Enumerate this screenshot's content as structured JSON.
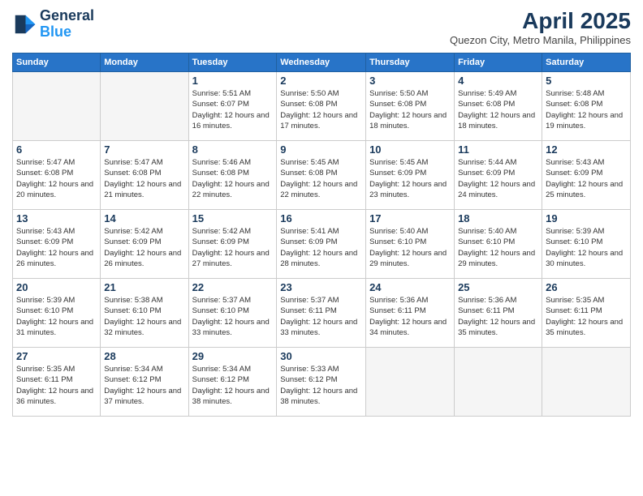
{
  "header": {
    "logo_line1": "General",
    "logo_line2": "Blue",
    "month_title": "April 2025",
    "location": "Quezon City, Metro Manila, Philippines"
  },
  "weekdays": [
    "Sunday",
    "Monday",
    "Tuesday",
    "Wednesday",
    "Thursday",
    "Friday",
    "Saturday"
  ],
  "weeks": [
    [
      {
        "day": "",
        "empty": true
      },
      {
        "day": "",
        "empty": true
      },
      {
        "day": "1",
        "sunrise": "Sunrise: 5:51 AM",
        "sunset": "Sunset: 6:07 PM",
        "daylight": "Daylight: 12 hours and 16 minutes."
      },
      {
        "day": "2",
        "sunrise": "Sunrise: 5:50 AM",
        "sunset": "Sunset: 6:08 PM",
        "daylight": "Daylight: 12 hours and 17 minutes."
      },
      {
        "day": "3",
        "sunrise": "Sunrise: 5:50 AM",
        "sunset": "Sunset: 6:08 PM",
        "daylight": "Daylight: 12 hours and 18 minutes."
      },
      {
        "day": "4",
        "sunrise": "Sunrise: 5:49 AM",
        "sunset": "Sunset: 6:08 PM",
        "daylight": "Daylight: 12 hours and 18 minutes."
      },
      {
        "day": "5",
        "sunrise": "Sunrise: 5:48 AM",
        "sunset": "Sunset: 6:08 PM",
        "daylight": "Daylight: 12 hours and 19 minutes."
      }
    ],
    [
      {
        "day": "6",
        "sunrise": "Sunrise: 5:47 AM",
        "sunset": "Sunset: 6:08 PM",
        "daylight": "Daylight: 12 hours and 20 minutes."
      },
      {
        "day": "7",
        "sunrise": "Sunrise: 5:47 AM",
        "sunset": "Sunset: 6:08 PM",
        "daylight": "Daylight: 12 hours and 21 minutes."
      },
      {
        "day": "8",
        "sunrise": "Sunrise: 5:46 AM",
        "sunset": "Sunset: 6:08 PM",
        "daylight": "Daylight: 12 hours and 22 minutes."
      },
      {
        "day": "9",
        "sunrise": "Sunrise: 5:45 AM",
        "sunset": "Sunset: 6:08 PM",
        "daylight": "Daylight: 12 hours and 22 minutes."
      },
      {
        "day": "10",
        "sunrise": "Sunrise: 5:45 AM",
        "sunset": "Sunset: 6:09 PM",
        "daylight": "Daylight: 12 hours and 23 minutes."
      },
      {
        "day": "11",
        "sunrise": "Sunrise: 5:44 AM",
        "sunset": "Sunset: 6:09 PM",
        "daylight": "Daylight: 12 hours and 24 minutes."
      },
      {
        "day": "12",
        "sunrise": "Sunrise: 5:43 AM",
        "sunset": "Sunset: 6:09 PM",
        "daylight": "Daylight: 12 hours and 25 minutes."
      }
    ],
    [
      {
        "day": "13",
        "sunrise": "Sunrise: 5:43 AM",
        "sunset": "Sunset: 6:09 PM",
        "daylight": "Daylight: 12 hours and 26 minutes."
      },
      {
        "day": "14",
        "sunrise": "Sunrise: 5:42 AM",
        "sunset": "Sunset: 6:09 PM",
        "daylight": "Daylight: 12 hours and 26 minutes."
      },
      {
        "day": "15",
        "sunrise": "Sunrise: 5:42 AM",
        "sunset": "Sunset: 6:09 PM",
        "daylight": "Daylight: 12 hours and 27 minutes."
      },
      {
        "day": "16",
        "sunrise": "Sunrise: 5:41 AM",
        "sunset": "Sunset: 6:09 PM",
        "daylight": "Daylight: 12 hours and 28 minutes."
      },
      {
        "day": "17",
        "sunrise": "Sunrise: 5:40 AM",
        "sunset": "Sunset: 6:10 PM",
        "daylight": "Daylight: 12 hours and 29 minutes."
      },
      {
        "day": "18",
        "sunrise": "Sunrise: 5:40 AM",
        "sunset": "Sunset: 6:10 PM",
        "daylight": "Daylight: 12 hours and 29 minutes."
      },
      {
        "day": "19",
        "sunrise": "Sunrise: 5:39 AM",
        "sunset": "Sunset: 6:10 PM",
        "daylight": "Daylight: 12 hours and 30 minutes."
      }
    ],
    [
      {
        "day": "20",
        "sunrise": "Sunrise: 5:39 AM",
        "sunset": "Sunset: 6:10 PM",
        "daylight": "Daylight: 12 hours and 31 minutes."
      },
      {
        "day": "21",
        "sunrise": "Sunrise: 5:38 AM",
        "sunset": "Sunset: 6:10 PM",
        "daylight": "Daylight: 12 hours and 32 minutes."
      },
      {
        "day": "22",
        "sunrise": "Sunrise: 5:37 AM",
        "sunset": "Sunset: 6:10 PM",
        "daylight": "Daylight: 12 hours and 33 minutes."
      },
      {
        "day": "23",
        "sunrise": "Sunrise: 5:37 AM",
        "sunset": "Sunset: 6:11 PM",
        "daylight": "Daylight: 12 hours and 33 minutes."
      },
      {
        "day": "24",
        "sunrise": "Sunrise: 5:36 AM",
        "sunset": "Sunset: 6:11 PM",
        "daylight": "Daylight: 12 hours and 34 minutes."
      },
      {
        "day": "25",
        "sunrise": "Sunrise: 5:36 AM",
        "sunset": "Sunset: 6:11 PM",
        "daylight": "Daylight: 12 hours and 35 minutes."
      },
      {
        "day": "26",
        "sunrise": "Sunrise: 5:35 AM",
        "sunset": "Sunset: 6:11 PM",
        "daylight": "Daylight: 12 hours and 35 minutes."
      }
    ],
    [
      {
        "day": "27",
        "sunrise": "Sunrise: 5:35 AM",
        "sunset": "Sunset: 6:11 PM",
        "daylight": "Daylight: 12 hours and 36 minutes."
      },
      {
        "day": "28",
        "sunrise": "Sunrise: 5:34 AM",
        "sunset": "Sunset: 6:12 PM",
        "daylight": "Daylight: 12 hours and 37 minutes."
      },
      {
        "day": "29",
        "sunrise": "Sunrise: 5:34 AM",
        "sunset": "Sunset: 6:12 PM",
        "daylight": "Daylight: 12 hours and 38 minutes."
      },
      {
        "day": "30",
        "sunrise": "Sunrise: 5:33 AM",
        "sunset": "Sunset: 6:12 PM",
        "daylight": "Daylight: 12 hours and 38 minutes."
      },
      {
        "day": "",
        "empty": true
      },
      {
        "day": "",
        "empty": true
      },
      {
        "day": "",
        "empty": true
      }
    ]
  ]
}
